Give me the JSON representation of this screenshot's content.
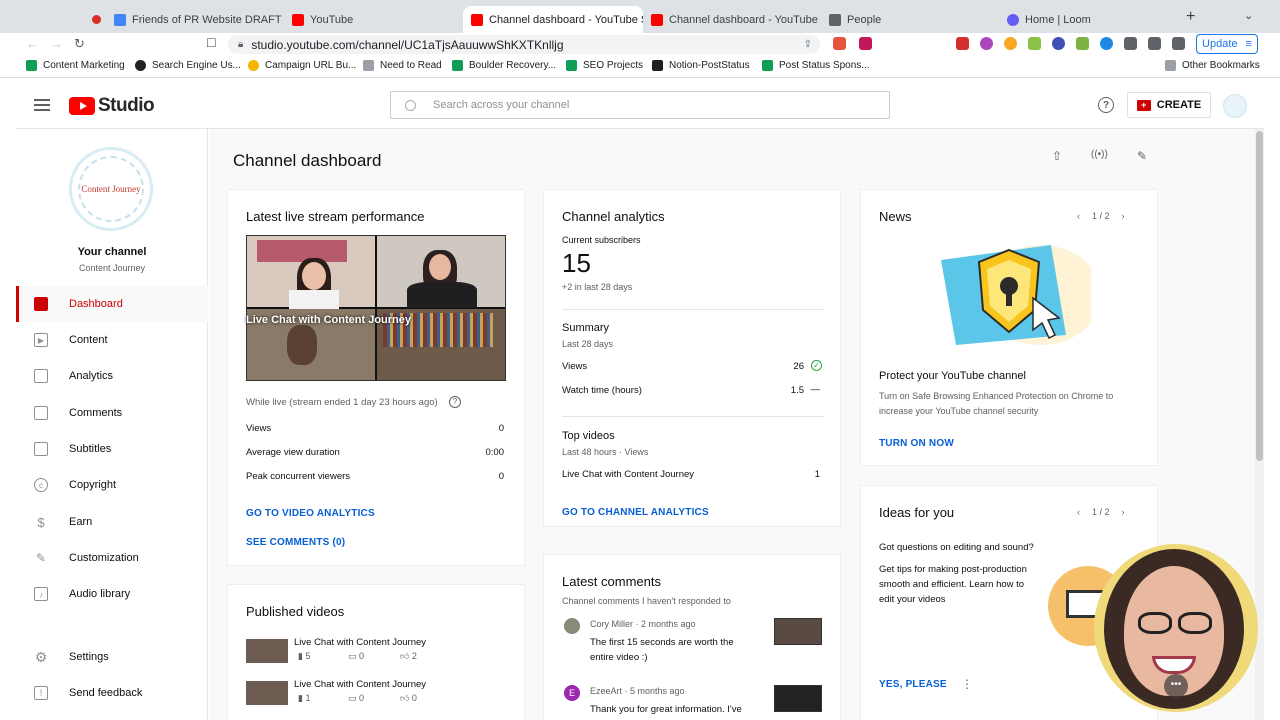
{
  "browser": {
    "tabs": [
      {
        "title": "Friends of PR Website DRAFT to cl",
        "active": false
      },
      {
        "title": "YouTube",
        "active": false
      },
      {
        "title": "Channel dashboard - YouTube S",
        "active": true
      },
      {
        "title": "Channel dashboard - YouTube Stud",
        "active": false
      },
      {
        "title": "People",
        "active": false
      },
      {
        "title": "Home | Loom",
        "active": false
      }
    ],
    "url": "studio.youtube.com/channel/UC1aTjsAauuwwShKXTKnlljg",
    "update_label": "Update",
    "bookmarks": [
      "Content Marketing",
      "Search Engine Us...",
      "Campaign URL Bu...",
      "Need to Read",
      "Boulder Recovery...",
      "SEO Projects",
      "Notion-PostStatus",
      "Post Status Spons..."
    ],
    "other_bookmarks": "Other Bookmarks"
  },
  "header": {
    "logo_text": "Studio",
    "search_placeholder": "Search across your channel",
    "help_glyph": "?",
    "create_label": "CREATE"
  },
  "sidebar": {
    "channel_title": "Your channel",
    "channel_name": "Content Journey",
    "avatar_text": "Content Journey",
    "items": [
      {
        "label": "Dashboard",
        "icon": "dashboard-icon",
        "active": true
      },
      {
        "label": "Content",
        "icon": "content-icon"
      },
      {
        "label": "Analytics",
        "icon": "analytics-icon"
      },
      {
        "label": "Comments",
        "icon": "comments-icon"
      },
      {
        "label": "Subtitles",
        "icon": "subtitles-icon"
      },
      {
        "label": "Copyright",
        "icon": "copyright-icon"
      },
      {
        "label": "Earn",
        "icon": "earn-icon"
      },
      {
        "label": "Customization",
        "icon": "customization-icon"
      },
      {
        "label": "Audio library",
        "icon": "audio-library-icon"
      }
    ],
    "bottom_items": [
      {
        "label": "Settings",
        "icon": "gear-icon"
      },
      {
        "label": "Send feedback",
        "icon": "feedback-icon"
      }
    ]
  },
  "main": {
    "title": "Channel dashboard",
    "live": {
      "title": "Latest live stream performance",
      "thumb_title": "Live Chat with Content Journey",
      "status": "While live (stream ended 1 day 23 hours ago)",
      "rows": [
        {
          "label": "Views",
          "value": "0"
        },
        {
          "label": "Average view duration",
          "value": "0:00"
        },
        {
          "label": "Peak concurrent viewers",
          "value": "0"
        }
      ],
      "link_analytics": "GO TO VIDEO ANALYTICS",
      "link_comments": "SEE COMMENTS (0)"
    },
    "published": {
      "title": "Published videos",
      "videos": [
        {
          "title": "Live Chat with Content Journey",
          "views": "5",
          "comments": "0",
          "likes": "2"
        },
        {
          "title": "Live Chat with Content Journey",
          "views": "1",
          "comments": "0",
          "likes": "0"
        }
      ]
    },
    "analytics": {
      "title": "Channel analytics",
      "subs_label": "Current subscribers",
      "subs_value": "15",
      "subs_change": "+2 in last 28 days",
      "summary_title": "Summary",
      "summary_period": "Last 28 days",
      "summary_rows": [
        {
          "label": "Views",
          "value": "26",
          "trend": "✓"
        },
        {
          "label": "Watch time (hours)",
          "value": "1.5",
          "trend": "—"
        }
      ],
      "top_title": "Top videos",
      "top_period": "Last 48 hours · Views",
      "top_rows": [
        {
          "label": "Live Chat with Content Journey",
          "value": "1"
        }
      ],
      "link": "GO TO CHANNEL ANALYTICS"
    },
    "comments": {
      "title": "Latest comments",
      "subtitle": "Channel comments I haven't responded to",
      "items": [
        {
          "author": "Cory Miller",
          "time": "2 months ago",
          "text1": "The first 15 seconds are worth the",
          "text2": "entire video :)"
        },
        {
          "author": "EzeeArt",
          "time": "5 months ago",
          "text1": "Thank you for great information. I've",
          "avatar_letter": "E"
        }
      ]
    },
    "news": {
      "title": "News",
      "pager": "1 / 2",
      "headline": "Protect your YouTube channel",
      "body1": "Turn on Safe Browsing Enhanced Protection on Chrome to",
      "body2": "increase your YouTube channel security",
      "link": "TURN ON NOW"
    },
    "ideas": {
      "title": "Ideas for you",
      "pager": "1 / 2",
      "headline": "Got questions on editing and sound?",
      "body1": "Get tips for making post-production",
      "body2": "smooth and efficient. Learn how to",
      "body3": "edit your videos",
      "link": "YES, PLEASE"
    }
  },
  "colors": {
    "accent_red": "#cc0000",
    "link_blue": "#065fd4",
    "youtube_red": "#ff0000"
  }
}
